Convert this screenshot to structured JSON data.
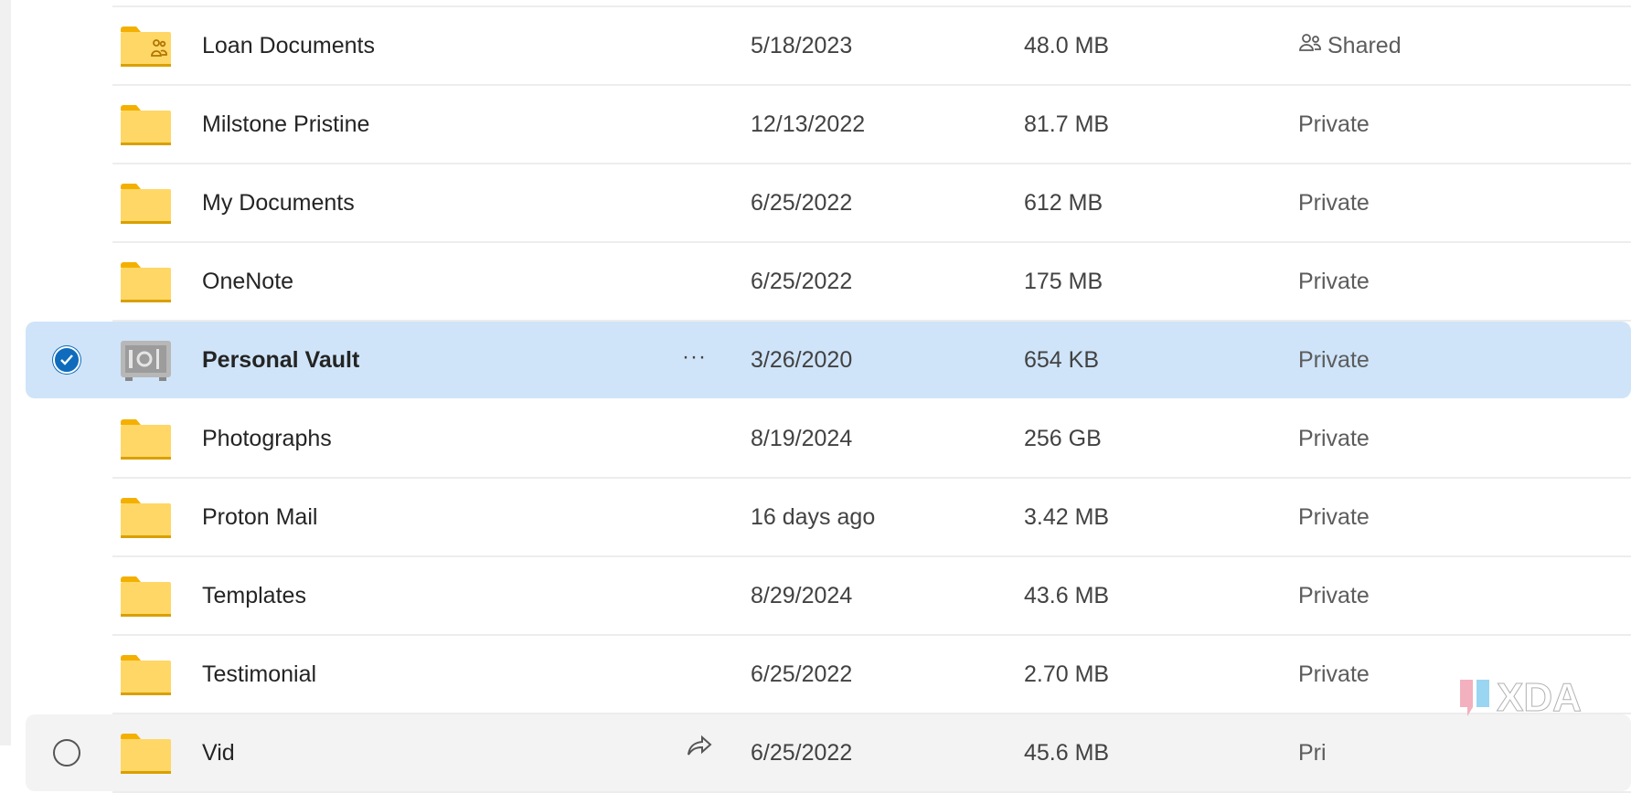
{
  "files": [
    {
      "name": "Loan Documents",
      "modified": "5/18/2023",
      "size": "48.0 MB",
      "sharing": "Shared",
      "icon": "shared-folder-icon",
      "state": "normal"
    },
    {
      "name": "Milstone Pristine",
      "modified": "12/13/2022",
      "size": "81.7 MB",
      "sharing": "Private",
      "icon": "folder-icon",
      "state": "normal"
    },
    {
      "name": "My Documents",
      "modified": "6/25/2022",
      "size": "612 MB",
      "sharing": "Private",
      "icon": "folder-icon",
      "state": "normal"
    },
    {
      "name": "OneNote",
      "modified": "6/25/2022",
      "size": "175 MB",
      "sharing": "Private",
      "icon": "folder-icon",
      "state": "normal"
    },
    {
      "name": "Personal Vault",
      "modified": "3/26/2020",
      "size": "654 KB",
      "sharing": "Private",
      "icon": "vault-icon",
      "state": "selected",
      "more": "···"
    },
    {
      "name": "Photographs",
      "modified": "8/19/2024",
      "size": "256 GB",
      "sharing": "Private",
      "icon": "folder-icon",
      "state": "normal"
    },
    {
      "name": "Proton Mail",
      "modified": "16 days ago",
      "size": "3.42 MB",
      "sharing": "Private",
      "icon": "folder-icon",
      "state": "normal"
    },
    {
      "name": "Templates",
      "modified": "8/29/2024",
      "size": "43.6 MB",
      "sharing": "Private",
      "icon": "folder-icon",
      "state": "normal"
    },
    {
      "name": "Testimonial",
      "modified": "6/25/2022",
      "size": "2.70 MB",
      "sharing": "Private",
      "icon": "folder-icon",
      "state": "normal"
    },
    {
      "name": "Vid",
      "modified": "6/25/2022",
      "size": "45.6 MB",
      "sharing": "Pri",
      "icon": "folder-icon",
      "state": "hover"
    }
  ],
  "colors": {
    "selected_row": "#cfe4f9",
    "folder": "#ffd766",
    "folder_tab": "#f4b000",
    "accent": "#0f6cbd"
  },
  "watermark": "XDA"
}
